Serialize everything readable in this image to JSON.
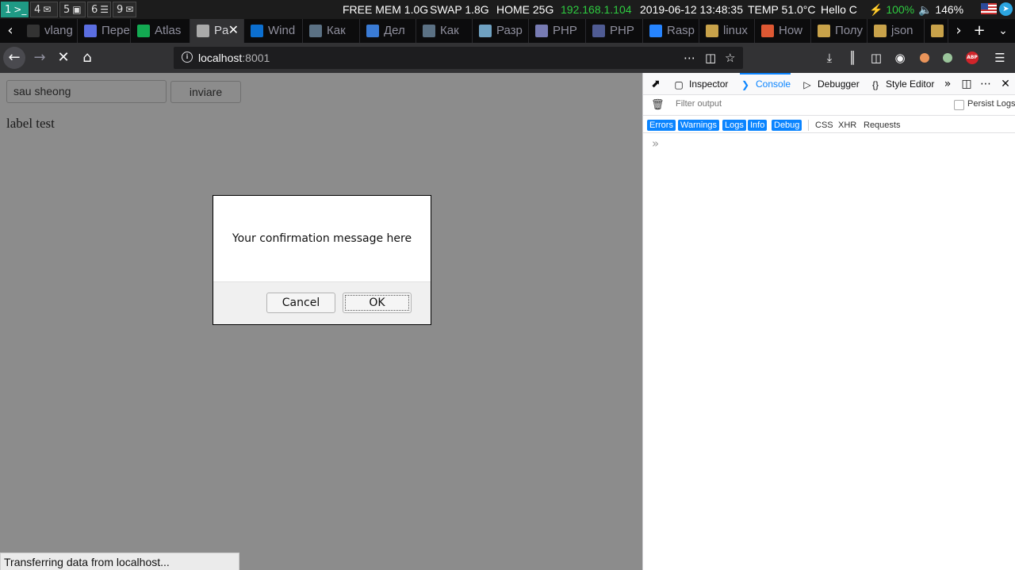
{
  "statusbar": {
    "workspaces": [
      {
        "label": "1",
        "icon": "terminal-icon",
        "glyph": ">_"
      },
      {
        "label": "4",
        "icon": "chat-icon",
        "glyph": "✉"
      },
      {
        "label": "5",
        "icon": "image-icon",
        "glyph": "▣"
      },
      {
        "label": "6",
        "icon": "document-icon",
        "glyph": "☰"
      },
      {
        "label": "9",
        "icon": "mail-icon",
        "glyph": "✉"
      }
    ],
    "free_mem": "FREE MEM 1.0G",
    "swap": "SWAP 1.8G",
    "home": "HOME 25G",
    "ip": "192.168.1.104",
    "datetime": "2019-06-12 13:48:35",
    "temp": "TEMP 51.0°C",
    "greeting": "Hello C",
    "battery": "⚡ 100%",
    "volume": "🔈 146%",
    "colors": {
      "active_ws": "#1f9a85",
      "ip": "#2ecc40"
    }
  },
  "tabs": [
    {
      "label": "vlang",
      "icon": "github-icon",
      "color": "#333"
    },
    {
      "label": "Пере",
      "icon": "translate-icon",
      "color": "#5b6ee1"
    },
    {
      "label": "Atlas",
      "icon": "atlas-icon",
      "color": "#13aa52"
    },
    {
      "label": "Pa",
      "icon": "loading-icon",
      "color": "#aaa"
    },
    {
      "label": "Wind",
      "icon": "page-icon",
      "color": "#0c6fd0"
    },
    {
      "label": "Как",
      "icon": "tproger-icon",
      "color": "#5b7184"
    },
    {
      "label": "Дел",
      "icon": "globe-icon",
      "color": "#3a7bd5"
    },
    {
      "label": "Как",
      "icon": "tproger-icon",
      "color": "#5b7184"
    },
    {
      "label": "Разр",
      "icon": "habr-icon",
      "color": "#6fa1c1"
    },
    {
      "label": "PHP",
      "icon": "php-icon",
      "color": "#777bb3"
    },
    {
      "label": "PHP",
      "icon": "php-icon",
      "color": "#4f5b93"
    },
    {
      "label": "Rasp",
      "icon": "atlassian-icon",
      "color": "#2684ff"
    },
    {
      "label": "linux",
      "icon": "glasses-icon",
      "color": "#c8a24a"
    },
    {
      "label": "How",
      "icon": "duck-icon",
      "color": "#de5833"
    },
    {
      "label": "Полу",
      "icon": "glasses-icon",
      "color": "#c8a24a"
    },
    {
      "label": "json",
      "icon": "glasses-icon",
      "color": "#c8a24a"
    },
    {
      "label": "",
      "icon": "glasses-icon",
      "color": "#c8a24a"
    }
  ],
  "navbar": {
    "url_host": "localhost",
    "url_port": ":8001"
  },
  "page": {
    "input_value": "sau sheong",
    "button_label": "inviare",
    "label_text": "label test",
    "modal_message": "Your confirmation message here",
    "modal_cancel": "Cancel",
    "modal_ok": "OK",
    "status_text": "Transferring data from localhost..."
  },
  "devtools": {
    "tabs": [
      {
        "label": "Inspector",
        "icon": "inspector-icon",
        "glyph": "▢"
      },
      {
        "label": "Console",
        "icon": "console-icon",
        "glyph": "❯",
        "active": true
      },
      {
        "label": "Debugger",
        "icon": "debugger-icon",
        "glyph": "▷"
      },
      {
        "label": "Style Editor",
        "icon": "style-editor-icon",
        "glyph": "{}"
      }
    ],
    "filter_placeholder": "Filter output",
    "persist_logs": "Persist Logs",
    "levels": [
      "Errors",
      "Warnings",
      "Logs",
      "Info",
      "Debug"
    ],
    "extra_filters": [
      "CSS",
      "XHR",
      "Requests"
    ],
    "prompt": "»",
    "accent": "#0a84ff"
  }
}
